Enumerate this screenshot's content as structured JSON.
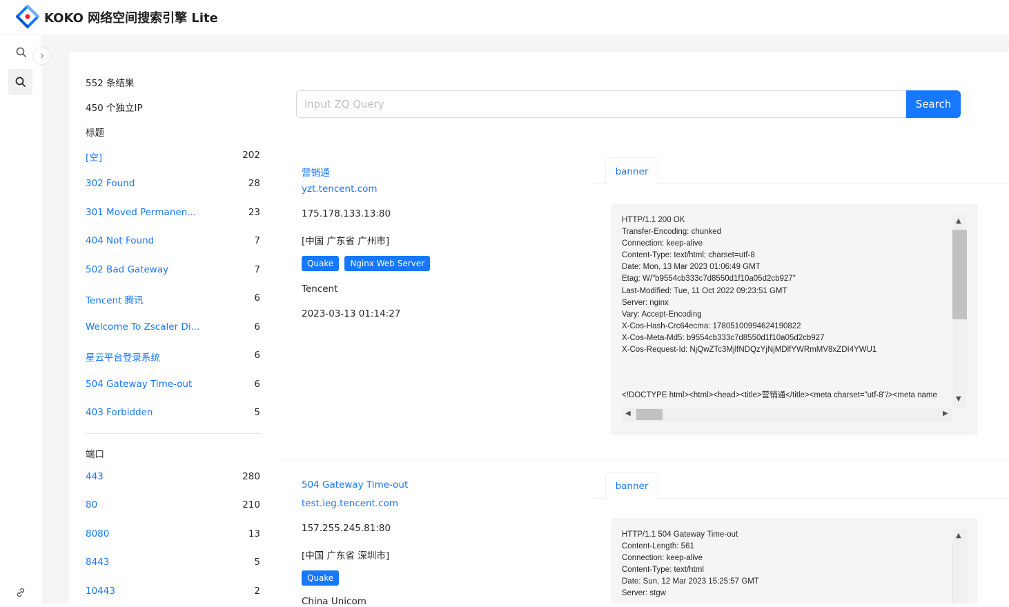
{
  "app": {
    "title": "KOKO 网络空间搜索引擎 Lite"
  },
  "stats": {
    "results": "552 条结果",
    "unique_ips": "450 个独立IP"
  },
  "facets": {
    "title_heading": "标题",
    "titles": [
      {
        "label": "[空]",
        "count": "202"
      },
      {
        "label": "302 Found",
        "count": "28"
      },
      {
        "label": "301 Moved Permanen...",
        "count": "23"
      },
      {
        "label": "404 Not Found",
        "count": "7"
      },
      {
        "label": "502 Bad Gateway",
        "count": "7"
      },
      {
        "label": "Tencent 腾讯",
        "count": "6"
      },
      {
        "label": "Welcome To Zscaler Di...",
        "count": "6"
      },
      {
        "label": "星云平台登录系统",
        "count": "6"
      },
      {
        "label": "504 Gateway Time-out",
        "count": "6"
      },
      {
        "label": "403 Forbidden",
        "count": "5"
      }
    ],
    "port_heading": "端口",
    "ports": [
      {
        "label": "443",
        "count": "280"
      },
      {
        "label": "80",
        "count": "210"
      },
      {
        "label": "8080",
        "count": "13"
      },
      {
        "label": "8443",
        "count": "5"
      },
      {
        "label": "10443",
        "count": "2"
      }
    ]
  },
  "search": {
    "placeholder": "input ZQ Query",
    "value": "",
    "button_label": "Search"
  },
  "results": [
    {
      "title": "营销通",
      "domain": "yzt.tencent.com",
      "address": "175.178.133.13:80",
      "location": "[中国 广东省 广州市]",
      "tags": [
        "Quake",
        "Nginx Web Server"
      ],
      "org": "Tencent",
      "time": "2023-03-13 01:14:27",
      "tab_label": "banner",
      "banner": [
        "HTTP/1.1 200 OK",
        "Transfer-Encoding: chunked",
        "Connection: keep-alive",
        "Content-Type: text/html; charset=utf-8",
        "Date: Mon, 13 Mar 2023 01:06:49 GMT",
        "Etag: W/\"b9554cb333c7d8550d1f10a05d2cb927\"",
        "Last-Modified: Tue, 11 Oct 2022 09:23:51 GMT",
        "Server: nginx",
        "Vary: Accept-Encoding",
        "X-Cos-Hash-Crc64ecma: 17805100994624190822",
        "X-Cos-Meta-Md5: b9554cb333c7d8550d1f10a05d2cb927",
        "X-Cos-Request-Id: NjQwZTc3MjlfNDQzYjNjMDlfYWRmMV8xZDI4YWU1",
        "",
        "",
        "",
        "<!DOCTYPE html><html><head><title>营销通</title><meta charset=\"utf-8\"/><meta name"
      ]
    },
    {
      "title": "504 Gateway Time-out",
      "domain": "test.ieg.tencent.com",
      "address": "157.255.245.81:80",
      "location": "[中国 广东省 深圳市]",
      "tags": [
        "Quake"
      ],
      "org": "China Unicom",
      "time": "",
      "tab_label": "banner",
      "banner": [
        "HTTP/1.1 504 Gateway Time-out",
        "Content-Length: 561",
        "Connection: keep-alive",
        "Content-Type: text/html",
        "Date: Sun, 12 Mar 2023 15:25:57 GMT",
        "Server: stgw"
      ]
    }
  ]
}
